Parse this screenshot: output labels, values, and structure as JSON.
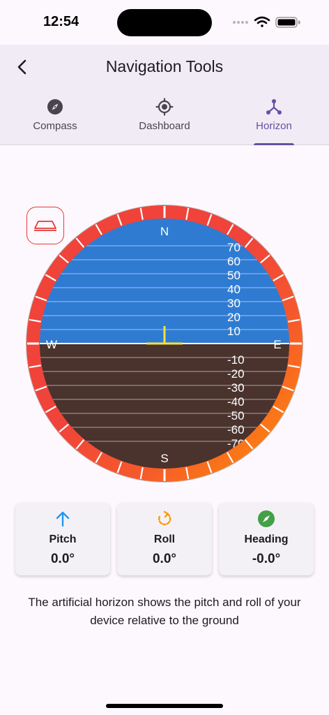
{
  "status_bar": {
    "time": "12:54"
  },
  "header": {
    "title": "Navigation Tools"
  },
  "tabs": [
    {
      "label": "Compass",
      "icon": "compass-icon",
      "active": false
    },
    {
      "label": "Dashboard",
      "icon": "gps-crosshair-icon",
      "active": false
    },
    {
      "label": "Horizon",
      "icon": "horizon-nodes-icon",
      "active": true
    }
  ],
  "attitude_indicator": {
    "cardinals": {
      "north": "N",
      "east": "E",
      "south": "S",
      "west": "W"
    },
    "pitch_labels_up": [
      "70",
      "60",
      "50",
      "40",
      "30",
      "20",
      "10"
    ],
    "pitch_labels_down": [
      "-10",
      "-20",
      "-30",
      "-40",
      "-50",
      "-60",
      "-70"
    ],
    "pitch": 0,
    "roll": 0,
    "colors": {
      "sky": "#2f7bd2",
      "ground": "#4a322d",
      "bezel_red": "#f0433a",
      "bezel_orange": "#ff9800",
      "aircraft": "#f5e23b"
    }
  },
  "cards": [
    {
      "label": "Pitch",
      "value": "0.0°",
      "icon": "arrow-up-icon",
      "color": "#2196f3"
    },
    {
      "label": "Roll",
      "value": "0.0°",
      "icon": "rotate-icon",
      "color": "#ff9800"
    },
    {
      "label": "Heading",
      "value": "-0.0°",
      "icon": "compass-icon",
      "color": "#43a047"
    }
  ],
  "description": "The artificial horizon shows the pitch and roll of your device relative to the ground"
}
